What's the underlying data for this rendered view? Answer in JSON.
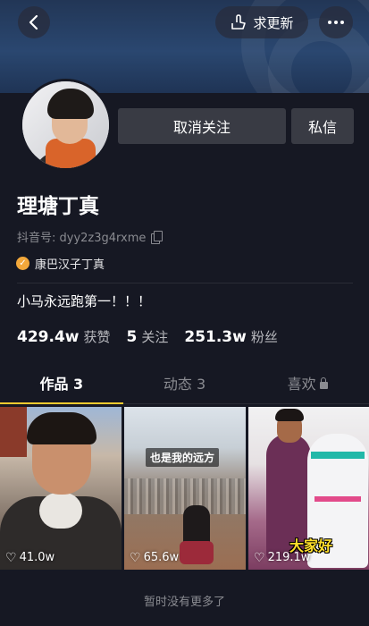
{
  "header": {
    "update_label": "求更新",
    "icons": [
      "back-icon",
      "hand-point-icon",
      "more-icon"
    ]
  },
  "profile": {
    "unfollow_label": "取消关注",
    "message_label": "私信",
    "name": "理塘丁真",
    "account_id": "抖音号: dyy2z3g4rxme",
    "verified_label": "康巴汉子丁真",
    "bio": "小马永远跑第一！！！"
  },
  "stats": [
    {
      "value": "429.4w",
      "label": "获赞"
    },
    {
      "value": "5",
      "label": "关注"
    },
    {
      "value": "251.3w",
      "label": "粉丝"
    }
  ],
  "tabs": [
    {
      "label": "作品 3"
    },
    {
      "label": "动态 3"
    },
    {
      "label": "喜欢"
    }
  ],
  "videos": [
    {
      "likes": "41.0w",
      "caption": ""
    },
    {
      "likes": "65.6w",
      "caption": "也是我的远方"
    },
    {
      "likes": "219.1w",
      "caption": "大家好"
    }
  ],
  "footer": {
    "no_more": "暂时没有更多了"
  },
  "colors": {
    "background": "#161823",
    "tab_indicator": "#facb2f",
    "verified": "#f3a83b"
  }
}
